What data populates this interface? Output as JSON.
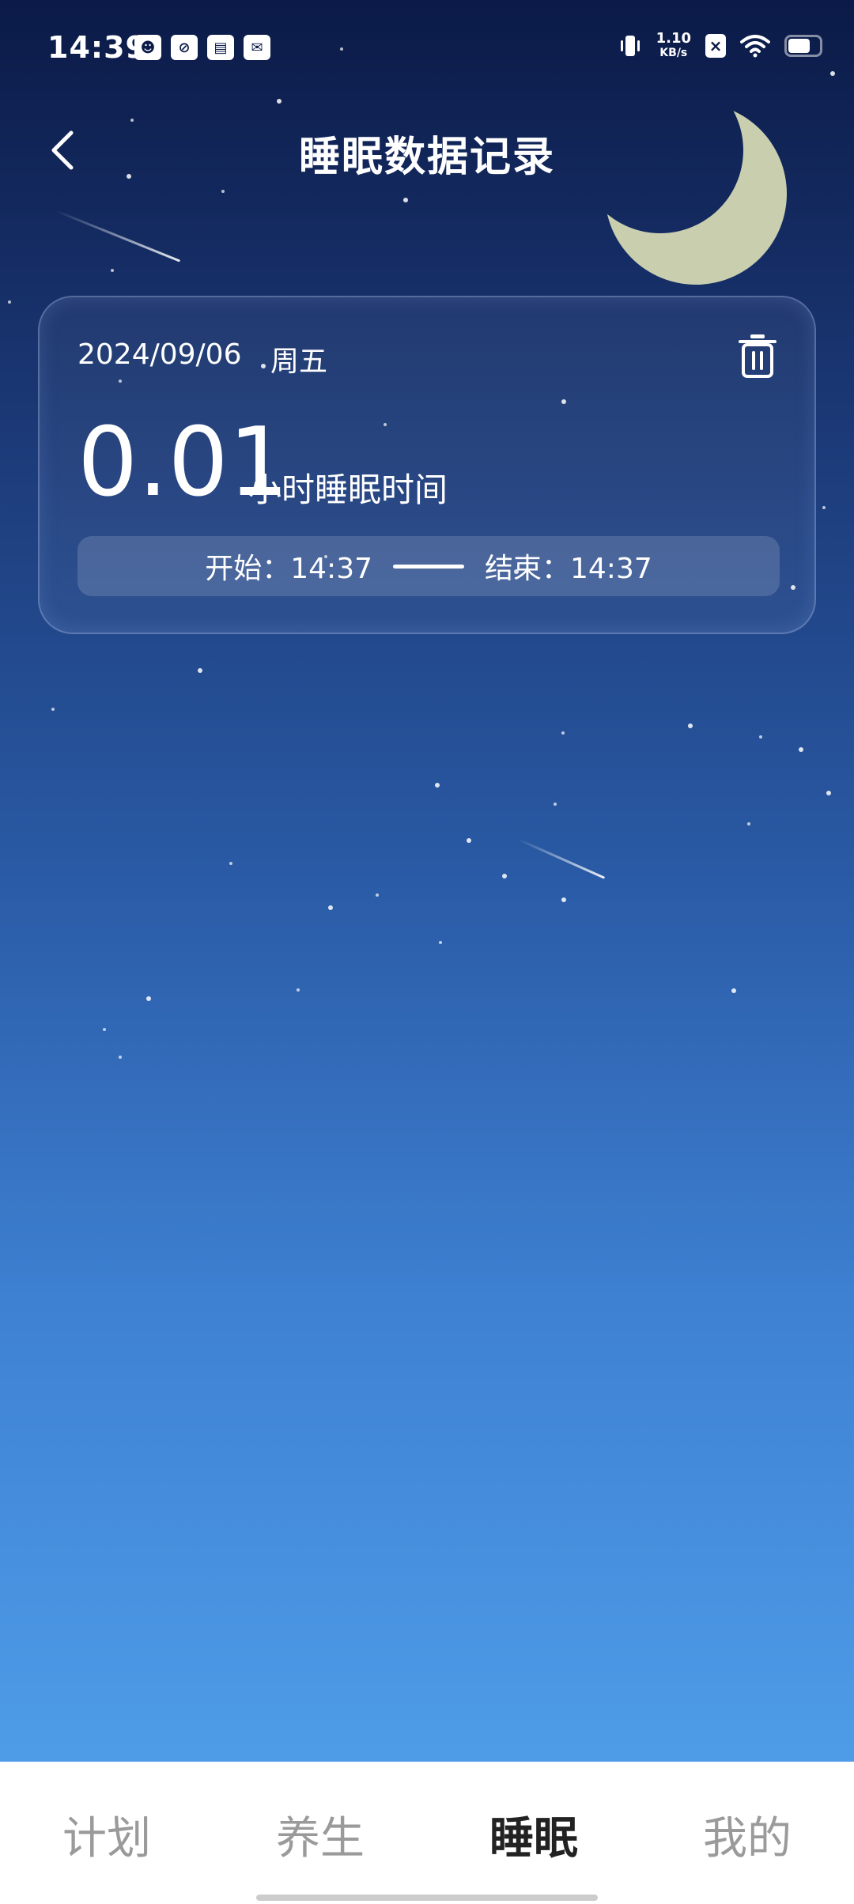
{
  "status_bar": {
    "time": "14:39",
    "left_icons": [
      "cat-app-icon",
      "swirl-app-icon",
      "archive-app-icon",
      "mail-app-icon"
    ],
    "net_speed_value": "1.10",
    "net_speed_unit": "KB/s",
    "right_icons": [
      "vibrate-icon",
      "sim-x-icon",
      "wifi-icon",
      "battery-icon"
    ],
    "battery_level": 0.7
  },
  "header": {
    "title": "睡眠数据记录",
    "back_icon": "chevron-left-icon"
  },
  "record_card": {
    "date": "2024/09/06",
    "weekday": "周五",
    "delete_icon": "trash-icon",
    "duration_value": "0.01",
    "duration_label": "小时睡眠时间",
    "start_text": "开始：14:37",
    "end_text": "结束：14:37"
  },
  "bottom_nav": {
    "items": [
      {
        "label": "计划"
      },
      {
        "label": "养生"
      },
      {
        "label": "睡眠"
      },
      {
        "label": "我的"
      }
    ],
    "active_index": 2
  },
  "colors": {
    "sky_top": "#0b1a47",
    "sky_bottom": "#4e9ce8",
    "moon": "#c9cfae",
    "nav_active": "#222222",
    "nav_inactive": "#9a9a9a"
  }
}
